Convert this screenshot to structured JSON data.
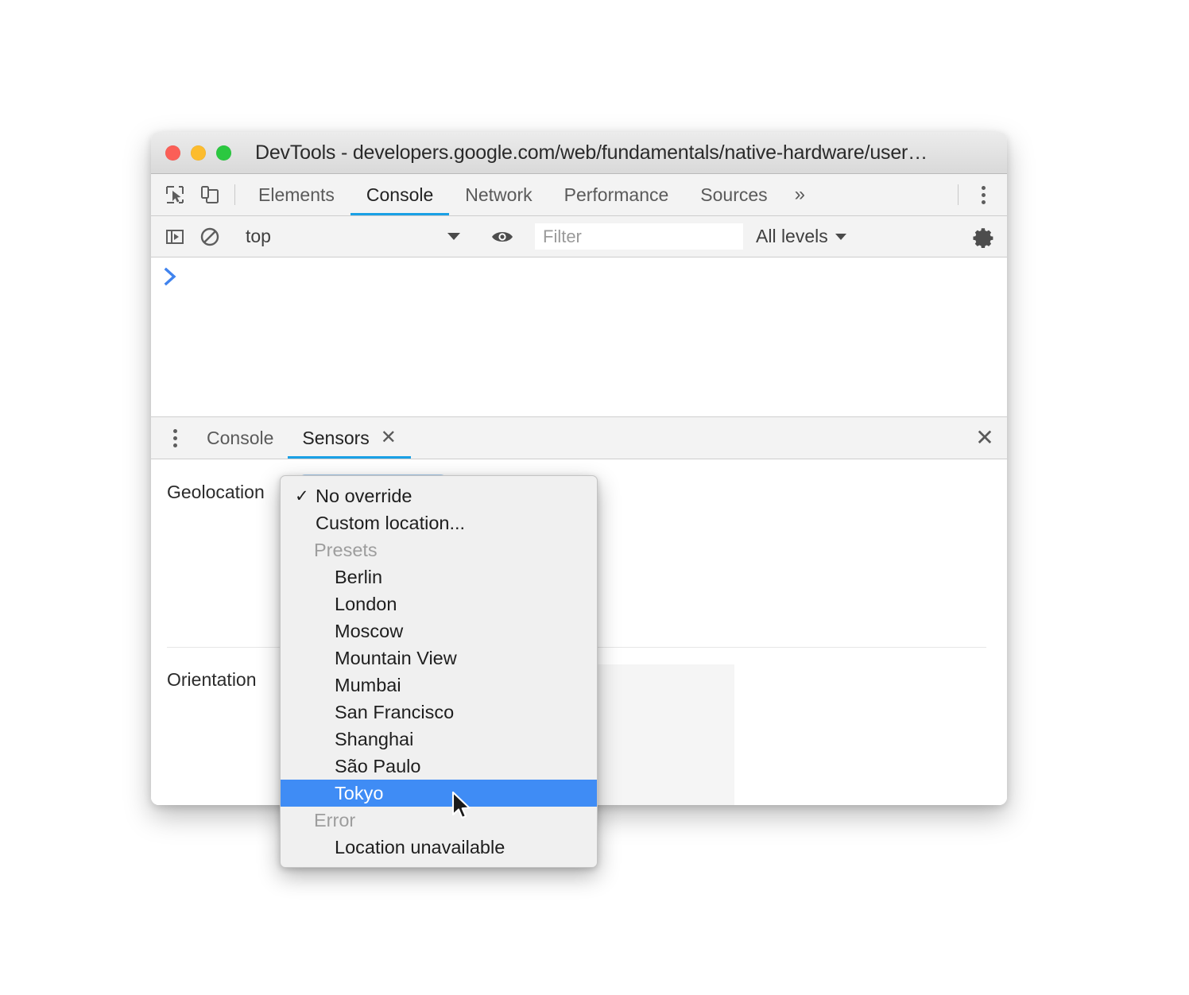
{
  "window": {
    "title": "DevTools - developers.google.com/web/fundamentals/native-hardware/user…",
    "traffic_lights": {
      "close_color": "#fb5f57",
      "minimize_color": "#fcbc2e",
      "zoom_color": "#2bc840"
    }
  },
  "main_toolbar": {
    "tabs": [
      {
        "label": "Elements",
        "active": false
      },
      {
        "label": "Console",
        "active": true
      },
      {
        "label": "Network",
        "active": false
      },
      {
        "label": "Performance",
        "active": false
      },
      {
        "label": "Sources",
        "active": false
      }
    ],
    "more_tabs_label": "»",
    "icons": {
      "inspect": "inspect-element-icon",
      "device": "device-toolbar-icon",
      "menu": "main-menu-kebab-icon"
    },
    "accent_color": "#1aa0e5"
  },
  "console_toolbar": {
    "context_value": "top",
    "filter_placeholder": "Filter",
    "filter_value": "",
    "levels_value": "All levels",
    "icons": {
      "sidebar": "console-sidebar-icon",
      "clear": "clear-console-icon",
      "eye": "live-expression-eye-icon",
      "settings": "settings-gear-icon"
    }
  },
  "console_output": {
    "prompt": "❯"
  },
  "drawer": {
    "menu_icon": "drawer-more-tabs-kebab-icon",
    "tabs": [
      {
        "label": "Console",
        "active": false,
        "closable": false
      },
      {
        "label": "Sensors",
        "active": true,
        "closable": true,
        "close_label": "✕"
      }
    ],
    "close_label": "✕",
    "accent_color": "#1aa0e5"
  },
  "sensors": {
    "geolocation_label": "Geolocation",
    "geolocation_value": "No override",
    "orientation_label": "Orientation",
    "orientation_value": "",
    "focus_ring_color": "#a8cdf0"
  },
  "geo_menu": {
    "highlight_color": "#3f8cf5",
    "items": [
      {
        "label": "No override",
        "type": "option",
        "checked": true,
        "selected": false
      },
      {
        "label": "Custom location...",
        "type": "option",
        "checked": false,
        "selected": false
      },
      {
        "label": "Presets",
        "type": "group",
        "checked": false,
        "selected": false
      },
      {
        "label": "Berlin",
        "type": "preset",
        "checked": false,
        "selected": false
      },
      {
        "label": "London",
        "type": "preset",
        "checked": false,
        "selected": false
      },
      {
        "label": "Moscow",
        "type": "preset",
        "checked": false,
        "selected": false
      },
      {
        "label": "Mountain View",
        "type": "preset",
        "checked": false,
        "selected": false
      },
      {
        "label": "Mumbai",
        "type": "preset",
        "checked": false,
        "selected": false
      },
      {
        "label": "San Francisco",
        "type": "preset",
        "checked": false,
        "selected": false
      },
      {
        "label": "Shanghai",
        "type": "preset",
        "checked": false,
        "selected": false
      },
      {
        "label": "São Paulo",
        "type": "preset",
        "checked": false,
        "selected": false
      },
      {
        "label": "Tokyo",
        "type": "preset",
        "checked": false,
        "selected": true
      },
      {
        "label": "Error",
        "type": "group",
        "checked": false,
        "selected": false
      },
      {
        "label": "Location unavailable",
        "type": "preset",
        "checked": false,
        "selected": false
      }
    ],
    "checkmark": "✓"
  }
}
